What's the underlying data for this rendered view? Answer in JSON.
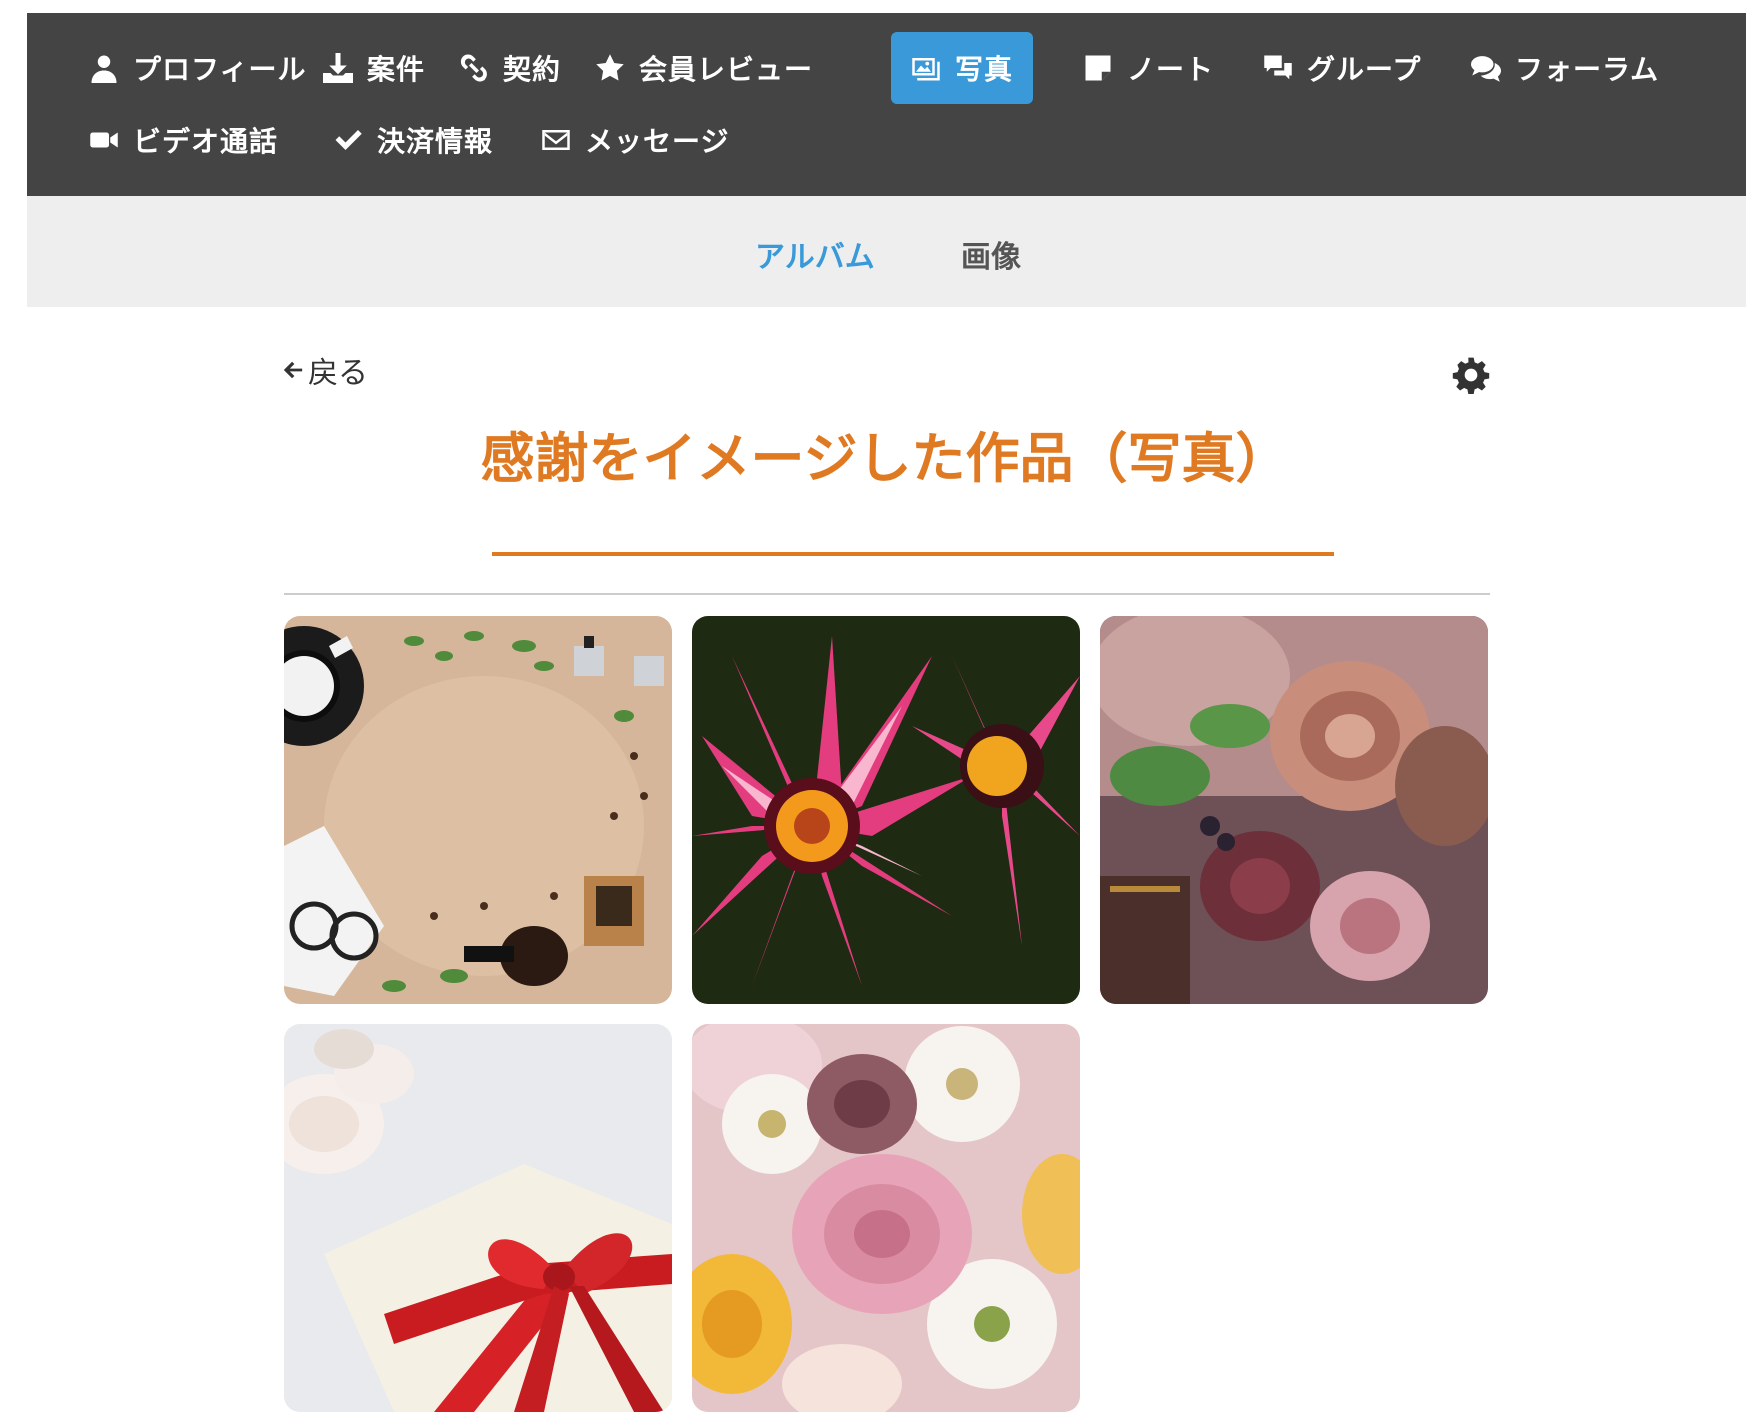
{
  "nav": {
    "items": [
      {
        "label": "プロフィール",
        "icon": "user-icon"
      },
      {
        "label": "案件",
        "icon": "download-icon"
      },
      {
        "label": "契約",
        "icon": "link-icon"
      },
      {
        "label": "会員レビュー",
        "icon": "star-icon"
      },
      {
        "label": "写真",
        "icon": "image-icon",
        "active": true
      },
      {
        "label": "ノート",
        "icon": "note-icon"
      },
      {
        "label": "グループ",
        "icon": "comments-icon"
      },
      {
        "label": "フォーラム",
        "icon": "chat-bubbles-icon"
      },
      {
        "label": "ビデオ通話",
        "icon": "video-camera-icon"
      },
      {
        "label": "決済情報",
        "icon": "check-icon"
      },
      {
        "label": "メッセージ",
        "icon": "envelope-icon"
      }
    ]
  },
  "subnav": {
    "tabs": [
      {
        "label": "アルバム",
        "active": true
      },
      {
        "label": "画像"
      }
    ]
  },
  "back_label": "戻る",
  "album": {
    "title": "感謝をイメージした作品（写真）"
  },
  "photos": [
    {
      "subject": "coffee flat lay with gifts and glasses"
    },
    {
      "subject": "pink gazania flowers"
    },
    {
      "subject": "dusty rose bouquet"
    },
    {
      "subject": "white gift box with red ribbon and roses"
    },
    {
      "subject": "pink roses and white gerbera bouquet"
    }
  ],
  "colors": {
    "nav_bg": "#444444",
    "nav_active": "#3a9ad9",
    "subnav_bg": "#eeeeee",
    "accent_orange": "#e07a22"
  }
}
